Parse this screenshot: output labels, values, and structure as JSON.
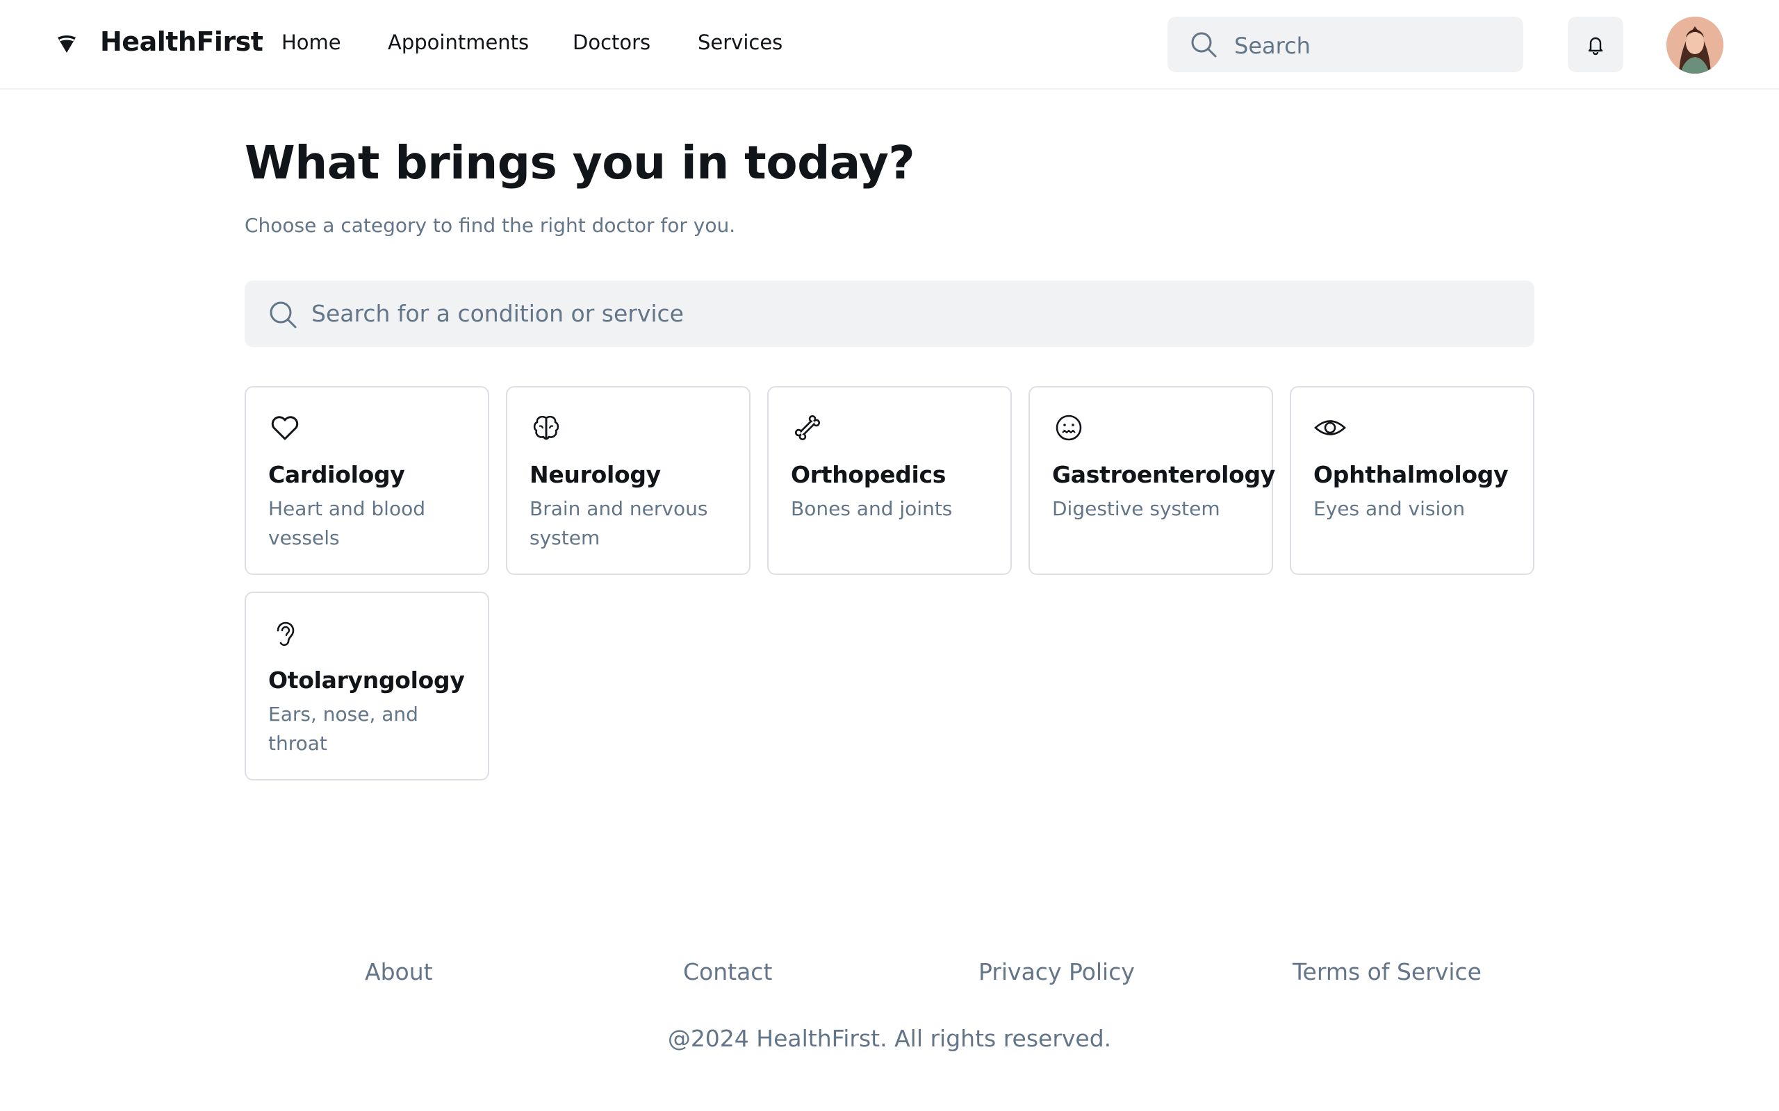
{
  "header": {
    "brand": "HealthFirst",
    "nav": [
      "Home",
      "Appointments",
      "Doctors",
      "Services"
    ],
    "search_placeholder": "Search"
  },
  "main": {
    "title": "What brings you in today?",
    "subtitle": "Choose a category to find the right doctor for you.",
    "search_placeholder": "Search for a condition or service",
    "categories": [
      {
        "name": "Cardiology",
        "description": "Heart and blood vessels",
        "icon": "heart-icon"
      },
      {
        "name": "Neurology",
        "description": "Brain and nervous system",
        "icon": "brain-icon"
      },
      {
        "name": "Orthopedics",
        "description": "Bones and joints",
        "icon": "bone-icon"
      },
      {
        "name": "Gastroenterology",
        "description": "Digestive system",
        "icon": "queasy-face-icon"
      },
      {
        "name": "Ophthalmology",
        "description": "Eyes and vision",
        "icon": "eye-icon"
      },
      {
        "name": "Otolaryngology",
        "description": "Ears, nose, and throat",
        "icon": "ear-icon"
      }
    ]
  },
  "footer": {
    "links": [
      "About",
      "Contact",
      "Privacy Policy",
      "Terms of Service"
    ],
    "copyright": "@2024 HealthFirst. All rights reserved."
  },
  "colors": {
    "text": "#111418",
    "muted": "#637588",
    "input_bg": "#f0f2f4",
    "border": "#dce0e5"
  }
}
